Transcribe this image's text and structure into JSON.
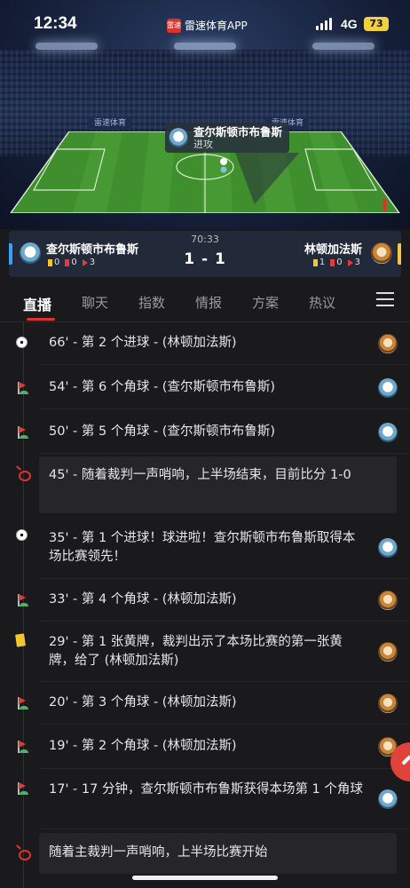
{
  "status_bar": {
    "time": "12:34",
    "app_logo_text": "雷速",
    "app_name": "雷速体育APP",
    "network": "4G",
    "battery": "73"
  },
  "stadium": {
    "ad_text": "雷速体育"
  },
  "popup": {
    "team": "查尔斯顿市布鲁斯",
    "event": "进攻"
  },
  "match": {
    "clock": "70:33",
    "score": "1 - 1",
    "home": {
      "name": "查尔斯顿市布鲁斯",
      "yellow": "0",
      "red": "0",
      "corners": "3"
    },
    "away": {
      "name": "林顿加法斯",
      "yellow": "1",
      "red": "0",
      "corners": "3"
    }
  },
  "tabs": [
    "直播",
    "聊天",
    "指数",
    "情报",
    "方案",
    "热议"
  ],
  "events": [
    {
      "icon": "goal-ball-icon",
      "text": "66' - 第 2 个进球 - (林顿加法斯)",
      "team": "away"
    },
    {
      "icon": "corner-flag-icon",
      "text": "54' - 第 6 个角球 - (查尔斯顿市布鲁斯)",
      "team": "home"
    },
    {
      "icon": "corner-flag-icon",
      "text": "50' - 第 5 个角球 - (查尔斯顿市布鲁斯)",
      "team": "home"
    },
    {
      "icon": "whistle-icon",
      "text": "45' - 随着裁判一声哨响，上半场结束，目前比分 1-0",
      "team": ""
    },
    {
      "icon": "goal-ball-icon",
      "text": "35' - 第 1 个进球！球进啦！查尔斯顿市布鲁斯取得本场比赛领先！",
      "team": "home"
    },
    {
      "icon": "corner-flag-icon",
      "text": "33' - 第 4 个角球 - (林顿加法斯)",
      "team": "away"
    },
    {
      "icon": "yellow-card-icon",
      "text": "29' - 第 1 张黄牌，裁判出示了本场比赛的第一张黄牌，给了 (林顿加法斯)",
      "team": "away"
    },
    {
      "icon": "corner-flag-icon",
      "text": "20' - 第 3 个角球 - (林顿加法斯)",
      "team": "away"
    },
    {
      "icon": "corner-flag-icon",
      "text": "19' - 第 2 个角球 - (林顿加法斯)",
      "team": "away"
    },
    {
      "icon": "corner-flag-icon",
      "text": "17' - 17 分钟，查尔斯顿市布鲁斯获得本场第 1 个角球",
      "team": "home"
    },
    {
      "icon": "whistle-icon",
      "text": "随着主裁判一声哨响，上半场比赛开始",
      "team": ""
    }
  ],
  "colors": {
    "accent": "#e0322d",
    "background": "#1a1a1d",
    "pitch": "#3f8f2e",
    "home_side": "#3aa0ff",
    "away_side": "#f0c84a"
  }
}
